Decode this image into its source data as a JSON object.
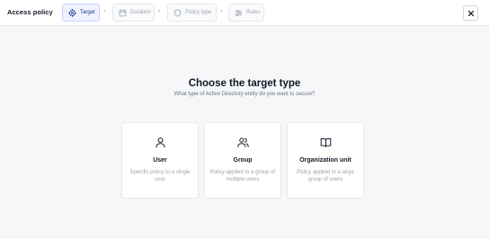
{
  "header": {
    "title": "Access policy",
    "separator": "›",
    "steps": [
      {
        "label": "Target",
        "icon": "target-icon",
        "active": true
      },
      {
        "label": "Duration",
        "icon": "calendar-icon",
        "active": false
      },
      {
        "label": "Policy type",
        "icon": "shield-icon",
        "active": false
      },
      {
        "label": "Rules",
        "icon": "sliders-icon",
        "active": false
      }
    ],
    "close_icon": "close-icon"
  },
  "main": {
    "heading": "Choose the target type",
    "subheading": "What type of Active Directory entity do you want to secure?",
    "options": [
      {
        "title": "User",
        "description": "Specific policy to a single user",
        "icon": "user-icon"
      },
      {
        "title": "Group",
        "description": "Policy applied to a group of multiple users",
        "icon": "users-icon"
      },
      {
        "title": "Organization unit",
        "description": "Policy applied to a large group of users",
        "icon": "book-open-icon"
      }
    ]
  },
  "colors": {
    "accent": "#1e3a8a",
    "active_step_bg": "#eef2ff",
    "page_bg": "#f6f7f9"
  }
}
